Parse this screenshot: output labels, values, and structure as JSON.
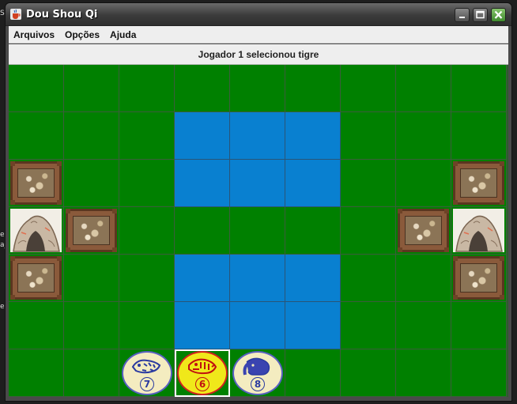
{
  "window": {
    "title": "Dou Shou Qi",
    "controls": [
      "minimize",
      "maximize",
      "close"
    ]
  },
  "desktop_fragments": [
    "Sbl",
    "er",
    "a_",
    "er"
  ],
  "menubar": {
    "items": [
      {
        "label": "Arquivos"
      },
      {
        "label": "Opções"
      },
      {
        "label": "Ajuda"
      }
    ]
  },
  "status": {
    "message": "Jogador 1 selecionou tigre"
  },
  "colors": {
    "land": "#008000",
    "water": "#0980d0",
    "trap": "#8a5a3b",
    "piece_blue": "#5860c0",
    "piece_red": "#d02020"
  },
  "board": {
    "rows": 7,
    "cols": 9,
    "water_cells": [
      [
        1,
        3
      ],
      [
        1,
        4
      ],
      [
        1,
        5
      ],
      [
        2,
        3
      ],
      [
        2,
        4
      ],
      [
        2,
        5
      ],
      [
        4,
        3
      ],
      [
        4,
        4
      ],
      [
        4,
        5
      ],
      [
        5,
        3
      ],
      [
        5,
        4
      ],
      [
        5,
        5
      ]
    ],
    "trap_cells": [
      [
        2,
        0
      ],
      [
        3,
        1
      ],
      [
        4,
        0
      ],
      [
        2,
        8
      ],
      [
        3,
        7
      ],
      [
        4,
        8
      ]
    ],
    "den_cells": [
      [
        3,
        0
      ],
      [
        3,
        8
      ]
    ],
    "selected_cell": [
      6,
      3
    ],
    "pieces": [
      {
        "row": 6,
        "col": 2,
        "animal": "leopard",
        "rank": "7",
        "player": "blue",
        "icon": "leopard-icon"
      },
      {
        "row": 6,
        "col": 3,
        "animal": "tiger",
        "rank": "6",
        "player": "red",
        "icon": "tiger-icon"
      },
      {
        "row": 6,
        "col": 4,
        "animal": "elephant",
        "rank": "8",
        "player": "blue",
        "icon": "elephant-icon"
      }
    ]
  }
}
